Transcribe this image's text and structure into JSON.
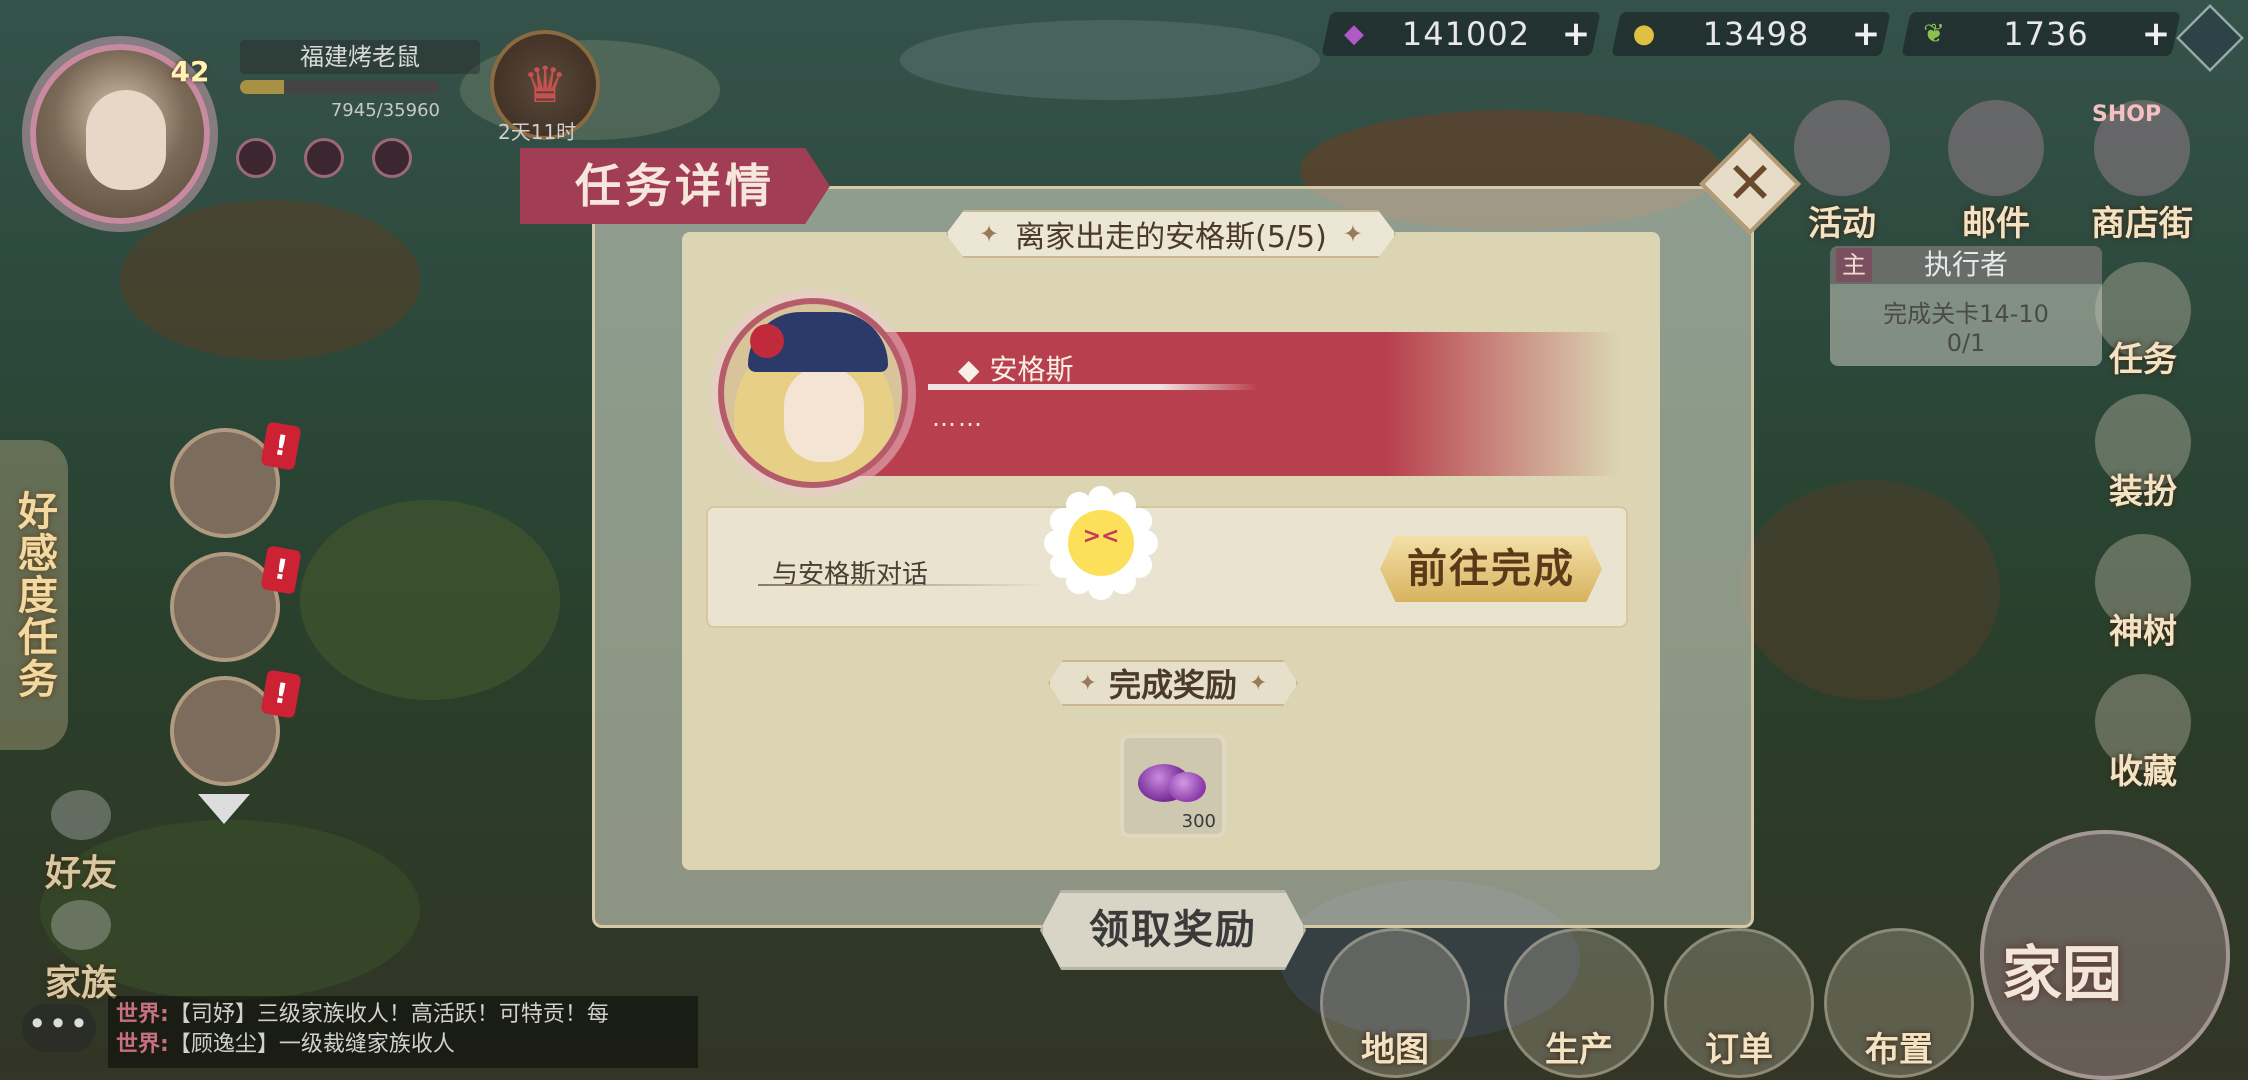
{
  "top_bar": {
    "currencies": [
      {
        "icon": "gem-icon",
        "value": "141002",
        "plus": "+",
        "color": "#b05ac8"
      },
      {
        "icon": "coin-icon",
        "value": "13498",
        "plus": "+",
        "color": "#e0c040"
      },
      {
        "icon": "leaf-icon",
        "value": "1736",
        "plus": "+",
        "color": "#8ac050"
      }
    ]
  },
  "player": {
    "level": "42",
    "name": "福建烤老鼠",
    "exp_text": "7945/35960",
    "exp_fraction": 0.22,
    "timer": "2天11时"
  },
  "left_panel": {
    "affection_tab": "好感度任务",
    "friends": "好友",
    "family": "家族"
  },
  "chat": {
    "lines": [
      {
        "channel": "世界:",
        "text": "【司妤】三级家族收人！高活跃！可特贡！每"
      },
      {
        "channel": "世界:",
        "text": "【顾逸尘】一级裁缝家族收人"
      }
    ]
  },
  "right_panel": {
    "top_menu": [
      "活动",
      "邮件",
      "商店街"
    ],
    "shop_tag": "SHOP",
    "executor": {
      "tag": "主",
      "title": "执行者",
      "task": "完成关卡14-10",
      "progress": "0/1"
    },
    "side_buttons": [
      "任务",
      "装扮",
      "神树",
      "收藏"
    ],
    "home": "家园",
    "bottom_buttons": [
      "地图",
      "生产",
      "订单",
      "布置"
    ]
  },
  "dialog": {
    "title": "任务详情",
    "close": "✕",
    "quest_title": "离家出走的安格斯(5/5)",
    "character_name": "安格斯",
    "character_line": "……",
    "task": "与安格斯对话",
    "go_button": "前往完成",
    "reward_title": "完成奖励",
    "reward": {
      "icon": "purple-gem-icon",
      "quantity": "300"
    },
    "claim_button": "领取奖励"
  }
}
